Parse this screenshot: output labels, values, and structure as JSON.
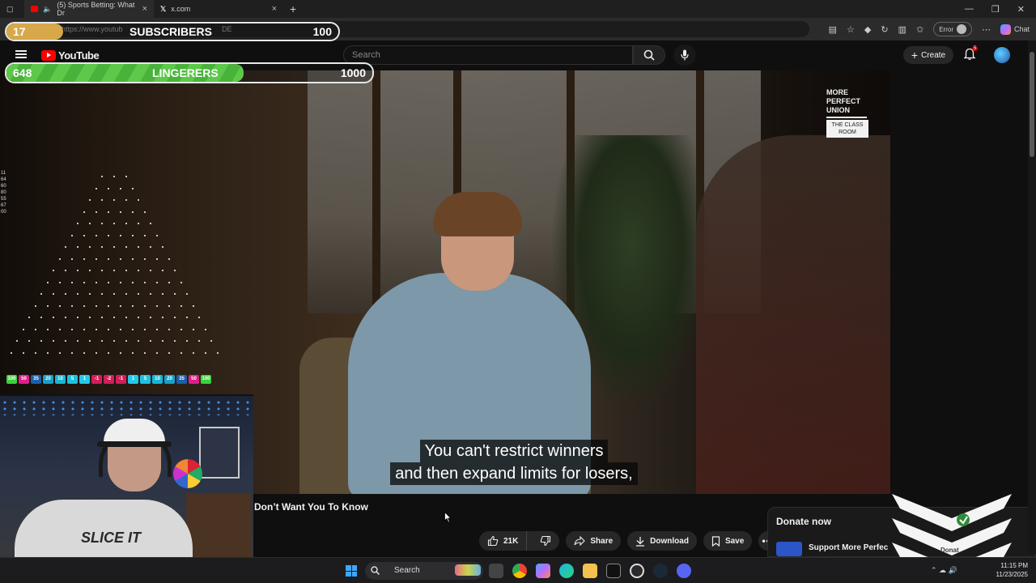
{
  "browser": {
    "tabs": [
      {
        "title": "(5) Sports Betting: What Dr",
        "active": true
      },
      {
        "title": "x.com",
        "active": false
      }
    ],
    "url": "https://www.youtub",
    "url_tail": "DE",
    "error_label": "Error",
    "chat_label": "Chat",
    "notification_count": "5"
  },
  "youtube": {
    "logo_text": "YouTube",
    "search_placeholder": "Search",
    "create_label": "Create",
    "video_title": "Don’t Want You To Know",
    "captions": [
      "You can't restrict winners",
      "and then expand limits for losers,"
    ],
    "watermark": {
      "line1": "MORE",
      "line2": "PERFECT",
      "line3": "UNION",
      "box": "THE CLASS ROOM"
    },
    "actions": {
      "likes": "21K",
      "share": "Share",
      "download": "Download",
      "save": "Save"
    },
    "donate": {
      "title": "Donate now",
      "support": "Support More Perfec",
      "partial": "Donat"
    }
  },
  "overlay": {
    "subscribers": {
      "current": "17",
      "label": "SUBSCRIBERS",
      "goal": "100",
      "progress": 0.17
    },
    "lingerers": {
      "current": "648",
      "label": "LINGERERS",
      "goal": "1000",
      "progress": 0.648
    },
    "plinko_side_nums": [
      "11",
      "64",
      "60",
      "80",
      "55",
      "67",
      "00"
    ],
    "plinko_slots": [
      {
        "v": "100",
        "c": "#3bd13b"
      },
      {
        "v": "50",
        "c": "#e01e8a"
      },
      {
        "v": "35",
        "c": "#1c5fa8"
      },
      {
        "v": "20",
        "c": "#1aa0c8"
      },
      {
        "v": "10",
        "c": "#19b5d6"
      },
      {
        "v": "5",
        "c": "#1fc0e0"
      },
      {
        "v": "1",
        "c": "#25c8e8"
      },
      {
        "v": "-1",
        "c": "#d11f5a"
      },
      {
        "v": "-2",
        "c": "#d11f5a"
      },
      {
        "v": "-1",
        "c": "#d11f5a"
      },
      {
        "v": "1",
        "c": "#25c8e8"
      },
      {
        "v": "5",
        "c": "#1fc0e0"
      },
      {
        "v": "10",
        "c": "#19b5d6"
      },
      {
        "v": "20",
        "c": "#1aa0c8"
      },
      {
        "v": "35",
        "c": "#1c5fa8"
      },
      {
        "v": "50",
        "c": "#e01e8a"
      },
      {
        "v": "100",
        "c": "#3bd13b"
      }
    ],
    "webcam_shirt": "SLICE IT"
  },
  "taskbar": {
    "search_label": "Search",
    "time": "11:15 PM",
    "date": "11/23/2025"
  },
  "colors": {
    "accent": "#ff0000",
    "subscriber_fill": "#d7a84a",
    "lingerer_fill": "#5ec84b"
  }
}
